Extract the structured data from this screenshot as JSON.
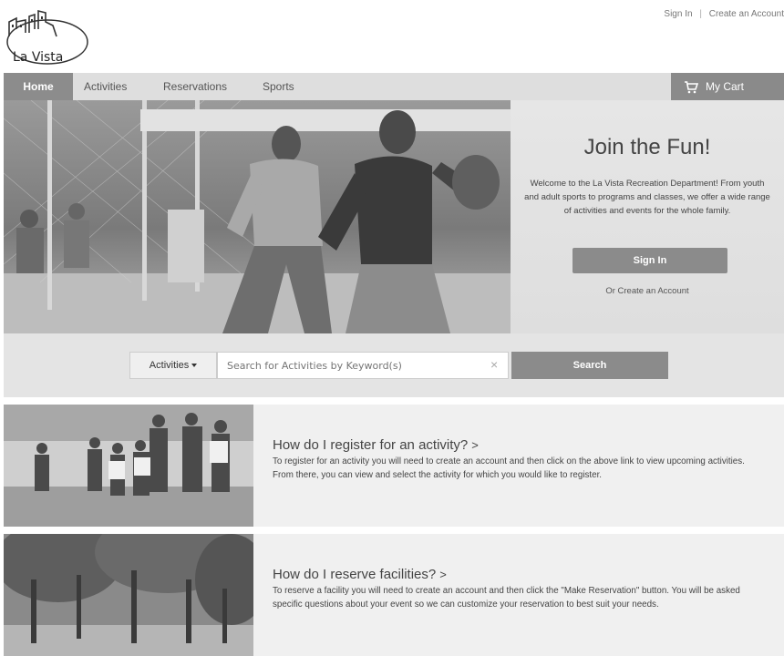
{
  "header": {
    "logo_text": "La Vista",
    "sign_in": "Sign In",
    "separator": "|",
    "create_account": "Create an Account"
  },
  "nav": {
    "items": [
      {
        "label": "Home"
      },
      {
        "label": "Activities"
      },
      {
        "label": "Reservations"
      },
      {
        "label": "Sports"
      }
    ],
    "cart_label": "My Cart"
  },
  "hero": {
    "title": "Join the Fun!",
    "text": "Welcome to the La Vista Recreation Department! From youth and adult sports to programs and classes, we offer a wide range of activities and events for the whole family.",
    "signin_button": "Sign In",
    "create_link": "Or Create an Account"
  },
  "search": {
    "dropdown_label": "Activities",
    "placeholder": "Search for Activities by Keyword(s)",
    "clear_symbol": "×",
    "button_label": "Search"
  },
  "info": [
    {
      "title": "How do I register for an activity?",
      "chevron": ">",
      "text": "To register for an activity you will need to create an account and then click on the above link to view upcoming activities. From there, you can view and select the activity for which you would like to register."
    },
    {
      "title": "How do I reserve facilities?",
      "chevron": ">",
      "text": "To reserve a facility you will need to create an account and then click the \"Make Reservation\" button. You will be asked specific questions about your event so we can customize your reservation to best suit your needs."
    }
  ]
}
